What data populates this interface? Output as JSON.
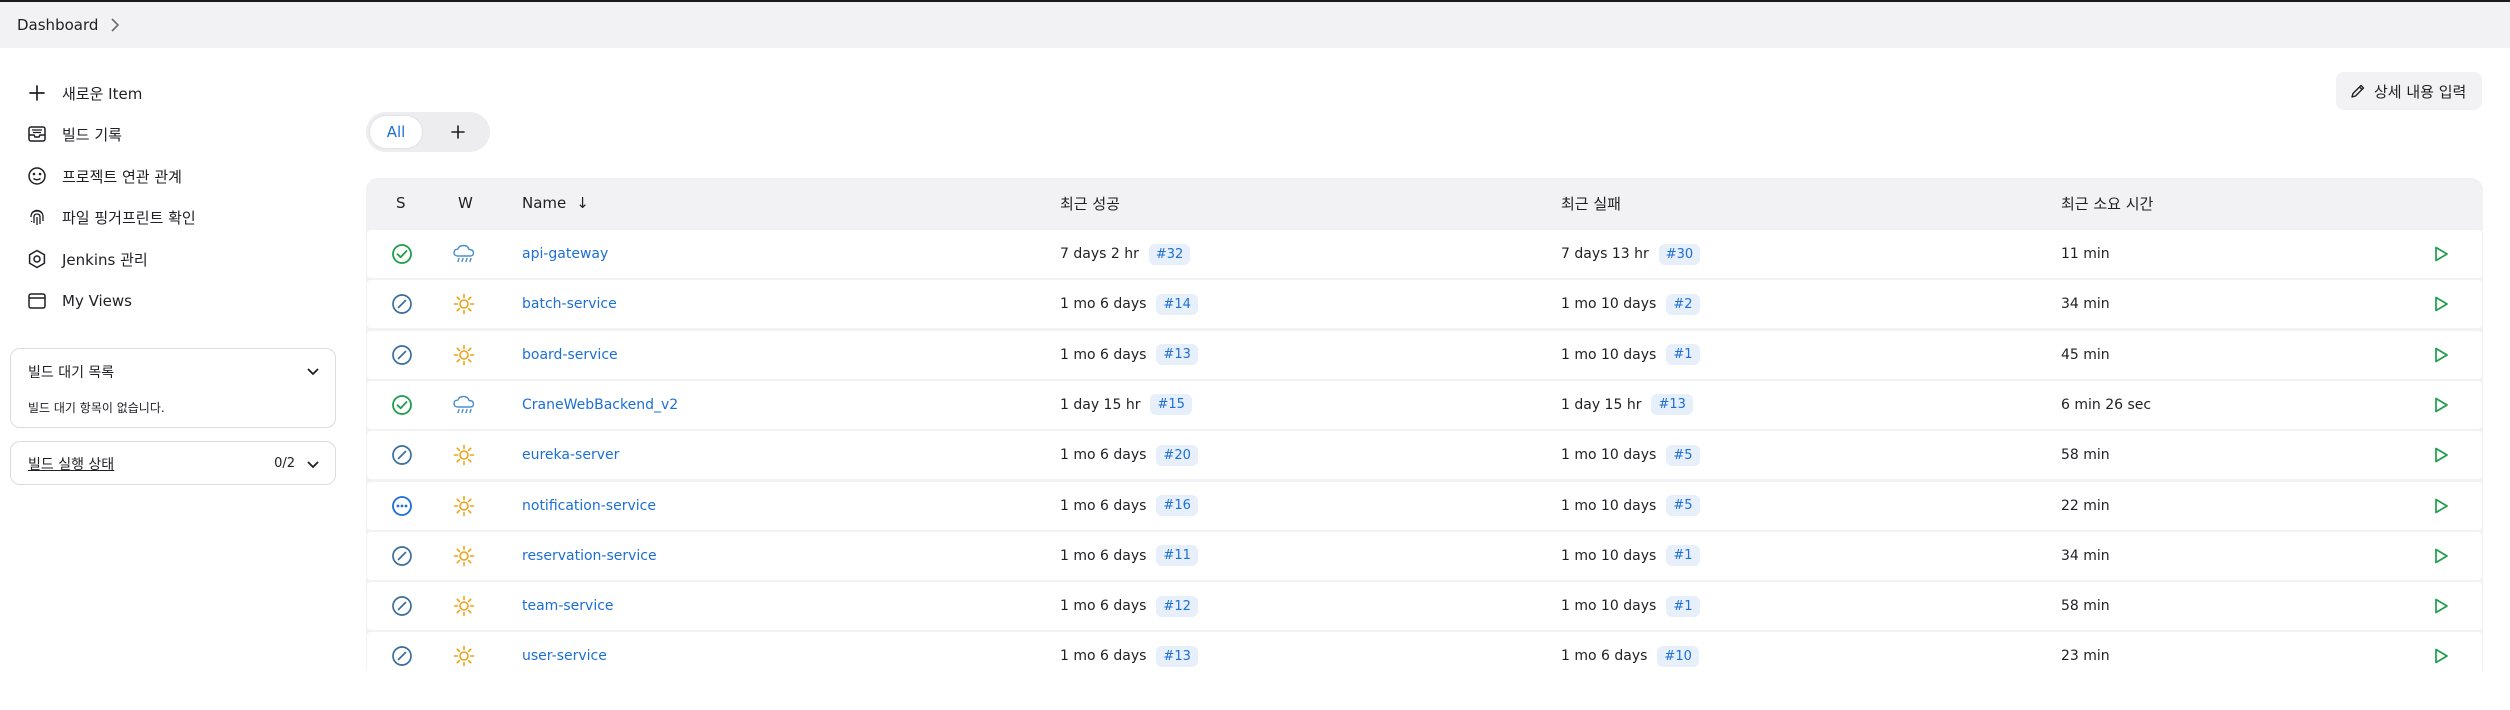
{
  "breadcrumb": {
    "root": "Dashboard"
  },
  "sidebar": {
    "items": [
      {
        "label": "새로운 Item",
        "icon": "plus-icon"
      },
      {
        "label": "빌드 기록",
        "icon": "inbox-icon"
      },
      {
        "label": "프로젝트 연관 관계",
        "icon": "relations-icon"
      },
      {
        "label": "파일 핑거프린트 확인",
        "icon": "fingerprint-icon"
      },
      {
        "label": "Jenkins 관리",
        "icon": "gear-icon"
      },
      {
        "label": "My Views",
        "icon": "window-icon"
      }
    ],
    "build_queue": {
      "title": "빌드 대기 목록",
      "empty_message": "빌드 대기 항목이 없습니다."
    },
    "executors": {
      "title": "빌드 실행 상태",
      "count": "0/2"
    }
  },
  "header": {
    "edit_description_label": "상세 내용 입력"
  },
  "view_tabs": {
    "active": "All",
    "add_symbol": "+"
  },
  "table": {
    "columns": {
      "status": "S",
      "weather": "W",
      "name": "Name",
      "sort_indicator": "↓",
      "last_success": "최근 성공",
      "last_failure": "최근 실패",
      "last_duration": "최근 소요 시간"
    },
    "rows": [
      {
        "status": "success",
        "weather": "rain",
        "name": "api-gateway",
        "last_success": "7 days 2 hr",
        "last_success_build": "#32",
        "last_failure": "7 days 13 hr",
        "last_failure_build": "#30",
        "duration": "11 min"
      },
      {
        "status": "aborted",
        "weather": "sunny",
        "name": "batch-service",
        "last_success": "1 mo 6 days",
        "last_success_build": "#14",
        "last_failure": "1 mo 10 days",
        "last_failure_build": "#2",
        "duration": "34 min"
      },
      {
        "status": "aborted",
        "weather": "sunny",
        "name": "board-service",
        "last_success": "1 mo 6 days",
        "last_success_build": "#13",
        "last_failure": "1 mo 10 days",
        "last_failure_build": "#1",
        "duration": "45 min"
      },
      {
        "status": "success",
        "weather": "rain",
        "name": "CraneWebBackend_v2",
        "last_success": "1 day 15 hr",
        "last_success_build": "#15",
        "last_failure": "1 day 15 hr",
        "last_failure_build": "#13",
        "duration": "6 min 26 sec"
      },
      {
        "status": "aborted",
        "weather": "sunny",
        "name": "eureka-server",
        "last_success": "1 mo 6 days",
        "last_success_build": "#20",
        "last_failure": "1 mo 10 days",
        "last_failure_build": "#5",
        "duration": "58 min"
      },
      {
        "status": "not-built",
        "weather": "sunny",
        "name": "notification-service",
        "last_success": "1 mo 6 days",
        "last_success_build": "#16",
        "last_failure": "1 mo 10 days",
        "last_failure_build": "#5",
        "duration": "22 min"
      },
      {
        "status": "aborted",
        "weather": "sunny",
        "name": "reservation-service",
        "last_success": "1 mo 6 days",
        "last_success_build": "#11",
        "last_failure": "1 mo 10 days",
        "last_failure_build": "#1",
        "duration": "34 min"
      },
      {
        "status": "aborted",
        "weather": "sunny",
        "name": "team-service",
        "last_success": "1 mo 6 days",
        "last_success_build": "#12",
        "last_failure": "1 mo 10 days",
        "last_failure_build": "#1",
        "duration": "58 min"
      },
      {
        "status": "aborted",
        "weather": "sunny",
        "name": "user-service",
        "last_success": "1 mo 6 days",
        "last_success_build": "#13",
        "last_failure": "1 mo 6 days",
        "last_failure_build": "#10",
        "duration": "23 min"
      }
    ]
  },
  "colors": {
    "accent": "#1b6fd6",
    "success": "#1e9e4a",
    "aborted": "#3a6e9e",
    "sunny": "#f0a11a",
    "rain": "#4a8fd0",
    "run": "#1e9e4a"
  }
}
